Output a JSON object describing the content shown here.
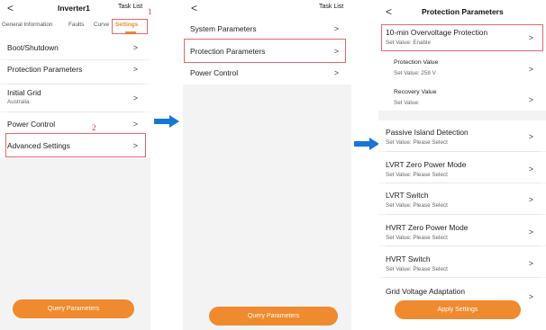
{
  "colors": {
    "accent": "#f08a2e",
    "highlight": "#e8666b",
    "arrow": "#1677d6"
  },
  "screen1": {
    "back": "<",
    "title": "Inverter1",
    "task_list": "Task List",
    "tabs": [
      "General Information",
      "Faults",
      "Curve",
      "Settings"
    ],
    "annotation_1": "1",
    "annotation_2": "2",
    "items": [
      {
        "label": "Boot/Shutdown",
        "sub": ""
      },
      {
        "label": "Protection Parameters",
        "sub": ""
      },
      {
        "label": "Initial Grid",
        "sub": "Australia"
      },
      {
        "label": "Power Control",
        "sub": ""
      },
      {
        "label": "Advanced Settings",
        "sub": ""
      }
    ],
    "chevron": ">",
    "button": "Query Parameters"
  },
  "screen2": {
    "back": "<",
    "task_list": "Task List",
    "items": [
      "System Parameters",
      "Protection Parameters",
      "Power Control"
    ],
    "chevron": ">",
    "button": "Query Parameters"
  },
  "screen3": {
    "back": "<",
    "title": "Protection Parameters",
    "items": [
      {
        "label": "10-min Overvoltage Protection",
        "sub": "Set Value: Enable"
      },
      {
        "label": "Protection Value",
        "sub": "Set Value: 258 V"
      },
      {
        "label": "Recovery Value",
        "sub": "Set Value:"
      },
      {
        "label": "Passive Island Detection",
        "sub": "Set Value: Please Select"
      },
      {
        "label": "LVRT Zero Power Mode",
        "sub": "Set Value: Please Select"
      },
      {
        "label": "LVRT Switch",
        "sub": "Set Value: Please Select"
      },
      {
        "label": "HVRT Zero Power Mode",
        "sub": "Set Value: Please Select"
      },
      {
        "label": "HVRT Switch",
        "sub": "Set Value: Please Select"
      },
      {
        "label": "Grid Voltage Adaptation",
        "sub": ""
      }
    ],
    "chevron": ">",
    "button": "Apply Settings"
  }
}
